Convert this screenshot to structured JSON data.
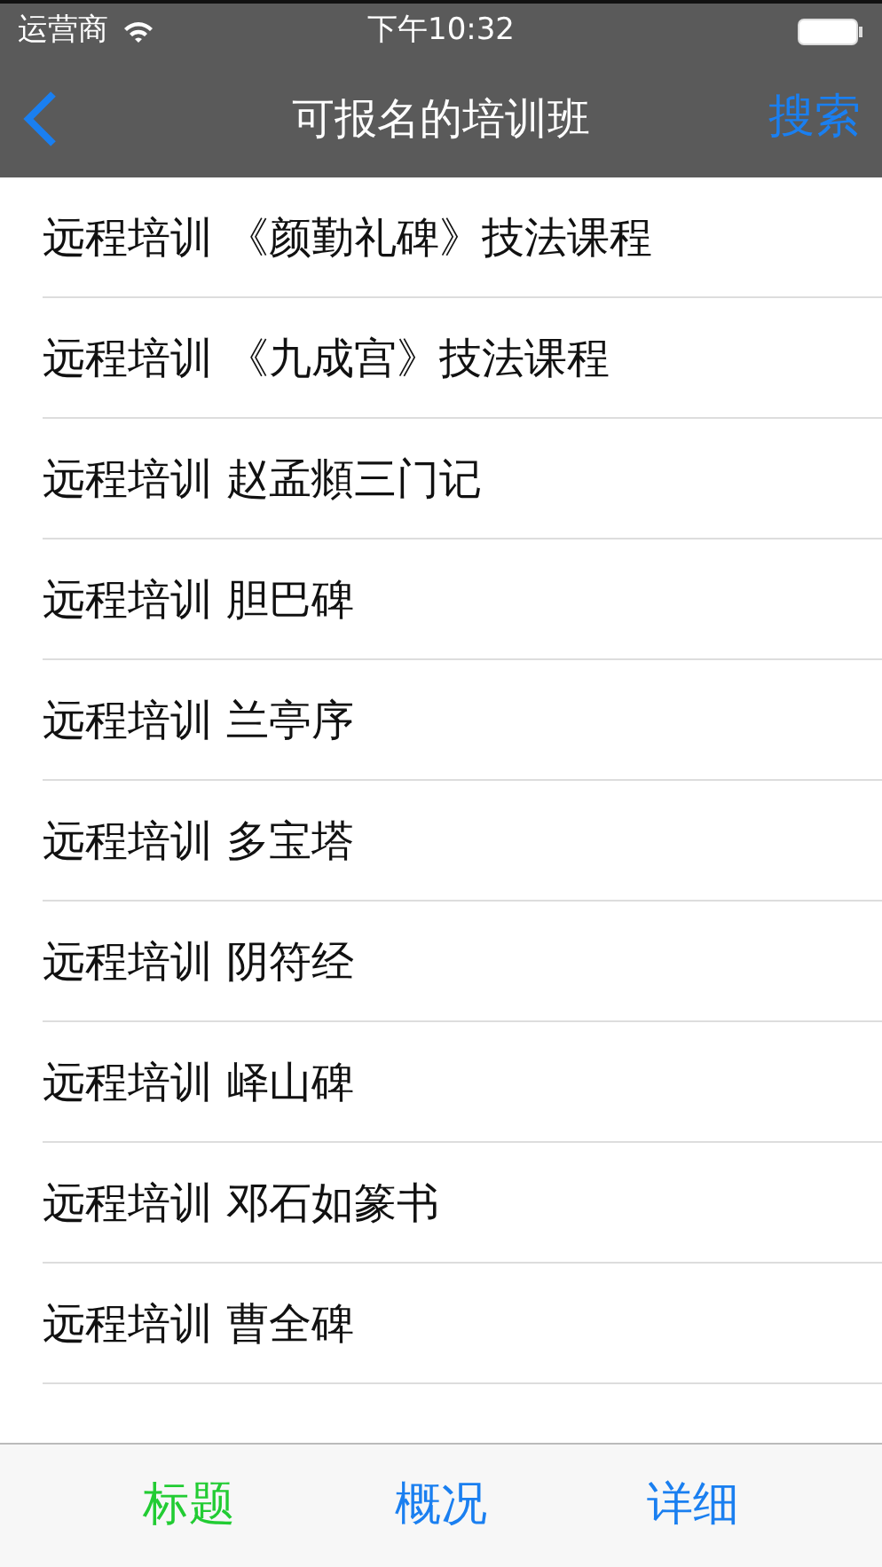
{
  "status_bar": {
    "carrier": "运营商",
    "time": "下午10:32"
  },
  "nav_bar": {
    "title": "可报名的培训班",
    "search": "搜索"
  },
  "courses": [
    {
      "title": "远程培训 《颜勤礼碑》技法课程"
    },
    {
      "title": "远程培训 《九成宫》技法课程"
    },
    {
      "title": "远程培训 赵孟頫三门记"
    },
    {
      "title": "远程培训 胆巴碑"
    },
    {
      "title": "远程培训 兰亭序"
    },
    {
      "title": "远程培训 多宝塔"
    },
    {
      "title": "远程培训 阴符经"
    },
    {
      "title": "远程培训 峄山碑"
    },
    {
      "title": "远程培训 邓石如篆书"
    },
    {
      "title": "远程培训 曹全碑"
    }
  ],
  "tabs": [
    {
      "label": "标题",
      "selected": true
    },
    {
      "label": "概况",
      "selected": false
    },
    {
      "label": "详细",
      "selected": false
    }
  ]
}
